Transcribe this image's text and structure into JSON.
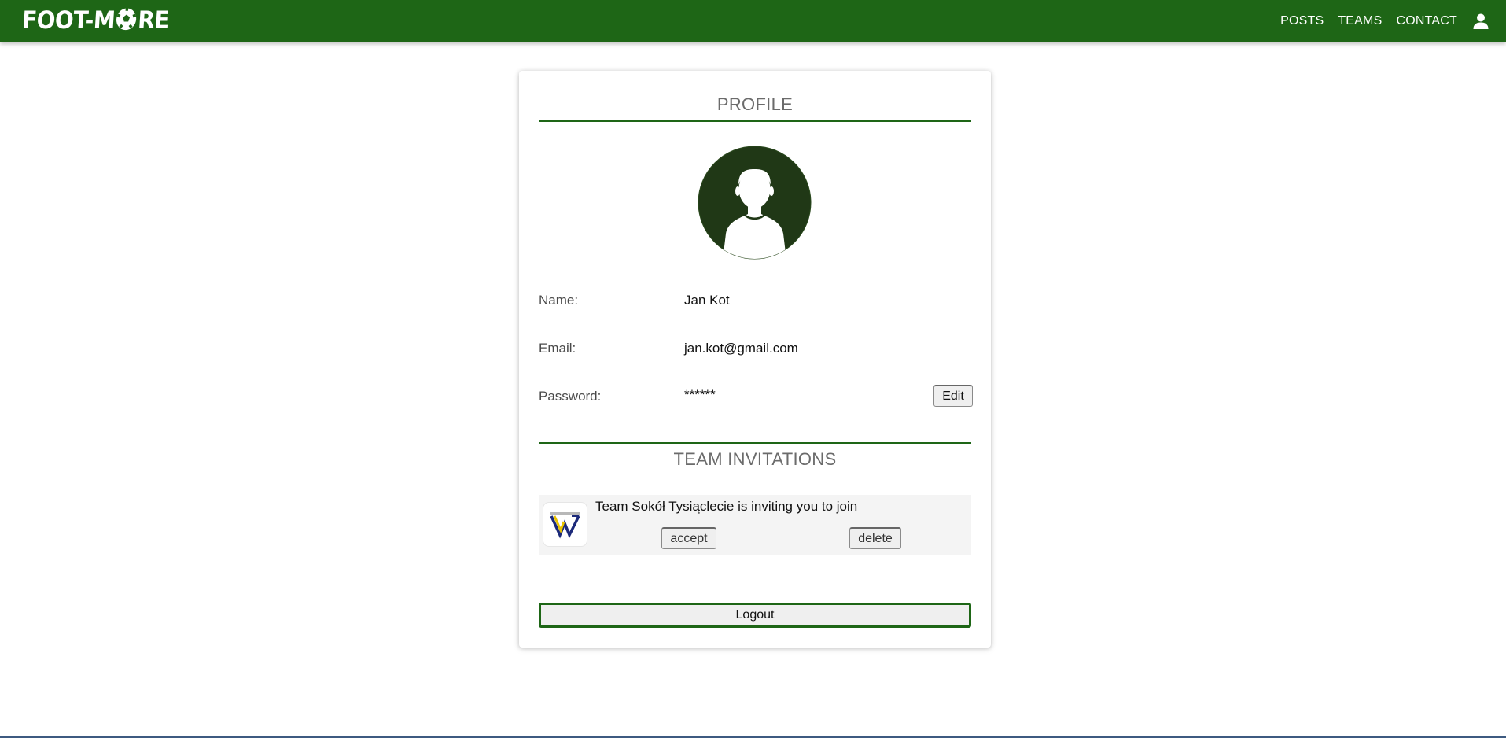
{
  "colors": {
    "brand": "#1e6616",
    "avatar": "#203816",
    "text_muted": "#6b6b6b"
  },
  "navbar": {
    "logo": {
      "prefix": "FOOT-M",
      "suffix": "RE",
      "ball_icon": "soccer-ball-icon"
    },
    "links": [
      "POSTS",
      "TEAMS",
      "CONTACT"
    ],
    "user_icon": "user-icon"
  },
  "profile": {
    "title": "PROFILE",
    "avatar_icon": "user-avatar-icon",
    "fields": {
      "name": {
        "label": "Name:",
        "value": "Jan Kot"
      },
      "email": {
        "label": "Email:",
        "value": "jan.kot@gmail.com"
      },
      "password": {
        "label": "Password:",
        "value": "******",
        "edit_label": "Edit"
      }
    }
  },
  "invitations": {
    "title": "TEAM INVITATIONS",
    "items": [
      {
        "team_logo_icon": "team-logo-icon",
        "text": "Team Sokół Tysiąclecie is inviting you to join",
        "accept_label": "accept",
        "delete_label": "delete"
      }
    ]
  },
  "logout_label": "Logout"
}
